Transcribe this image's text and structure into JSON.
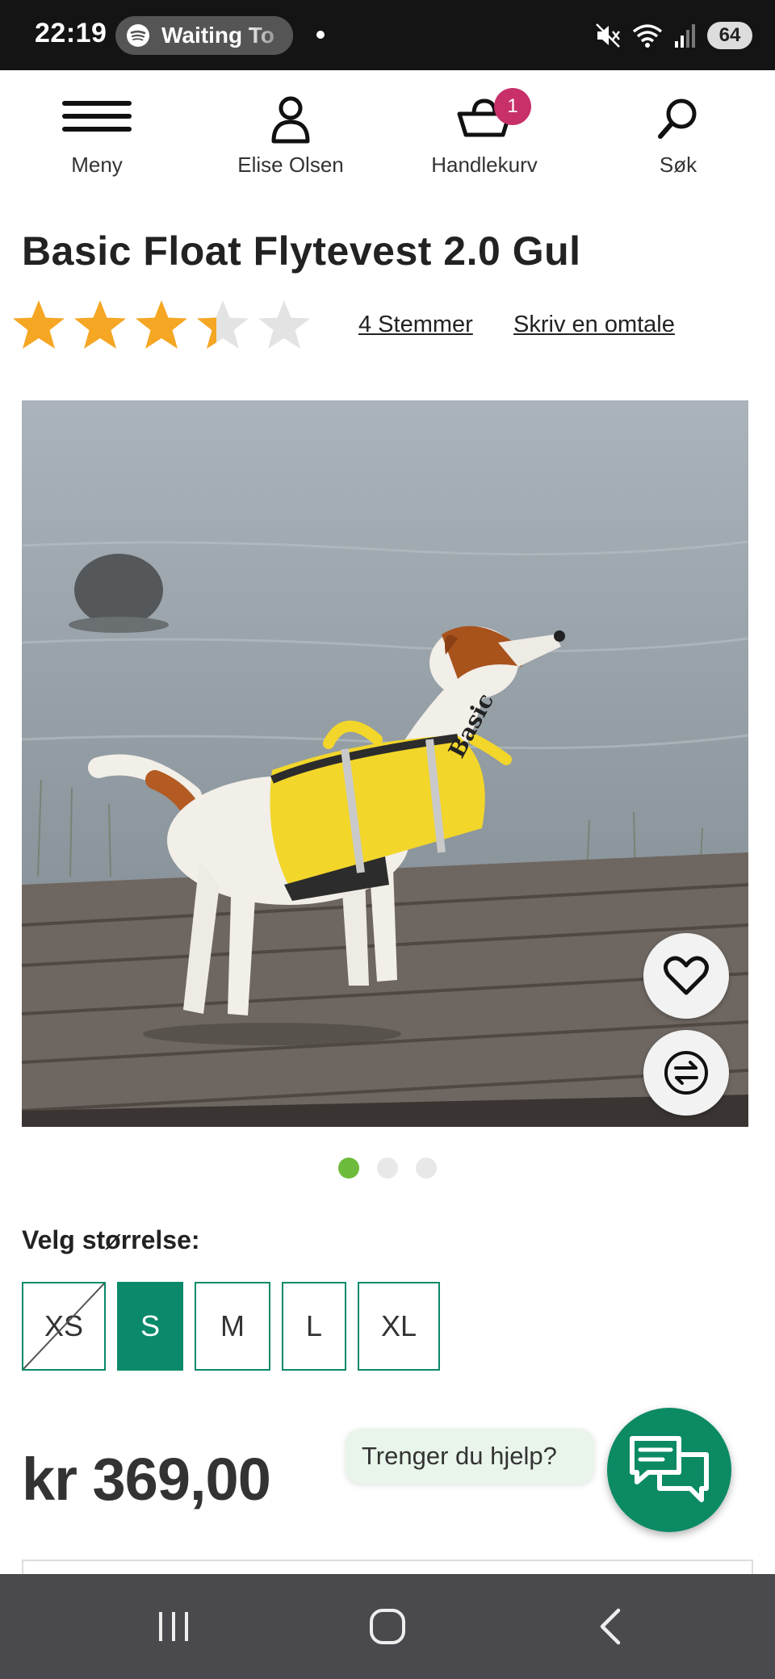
{
  "status_bar": {
    "time": "22:19",
    "media_text": "Waiting To",
    "battery": "64",
    "icons": [
      "spotify-icon",
      "mute-icon",
      "wifi-icon",
      "signal-icon",
      "battery-icon"
    ]
  },
  "header": {
    "menu_label": "Meny",
    "account_label": "Elise Olsen",
    "cart_label": "Handlekurv",
    "cart_count": "1",
    "search_label": "Søk"
  },
  "product": {
    "title": "Basic Float Flytevest 2.0 Gul",
    "rating": 3.5,
    "rating_max": 5,
    "votes_link": "4 Stemmer",
    "review_link": "Skriv en omtale",
    "image_count": 3,
    "active_image": 1,
    "vest_brand": "Basic"
  },
  "sizes": {
    "label": "Velg størrelse:",
    "options": [
      {
        "label": "XS",
        "available": false
      },
      {
        "label": "S",
        "selected": true
      },
      {
        "label": "M"
      },
      {
        "label": "L"
      },
      {
        "label": "XL"
      }
    ]
  },
  "price": "kr 369,00",
  "help": {
    "bubble_text": "Trenger du hjelp?"
  },
  "colors": {
    "accent_green": "#0a8a6a",
    "badge_pink": "#c8306a",
    "star_orange": "#f5a623",
    "dot_active": "#6dbb3a"
  }
}
